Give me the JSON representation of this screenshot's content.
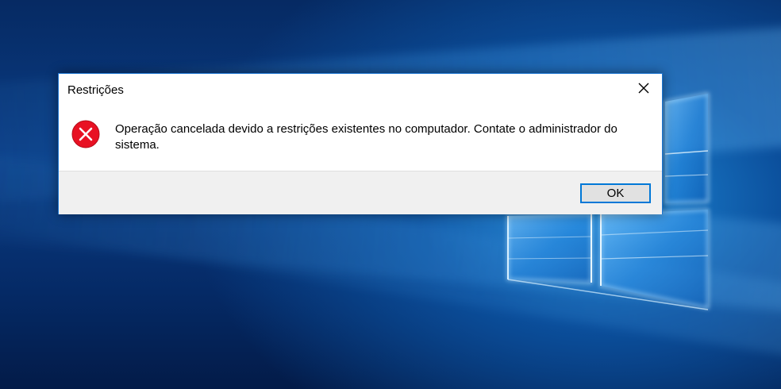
{
  "desktop": {
    "wallpaper": "windows-10-hero",
    "colors": {
      "background_dark": "#062a63",
      "background_mid": "#0a3d85",
      "logo_glow": "#8fd3ff"
    }
  },
  "dialog": {
    "title": "Restrições",
    "icon": "error-icon",
    "message": "Operação cancelada devido a restrições existentes no computador. Contate o administrador do sistema.",
    "ok_label": "OK",
    "colors": {
      "border": "#1b74d0",
      "error_red": "#e81123",
      "footer_bg": "#f0f0f0",
      "button_border": "#0078d7"
    }
  }
}
